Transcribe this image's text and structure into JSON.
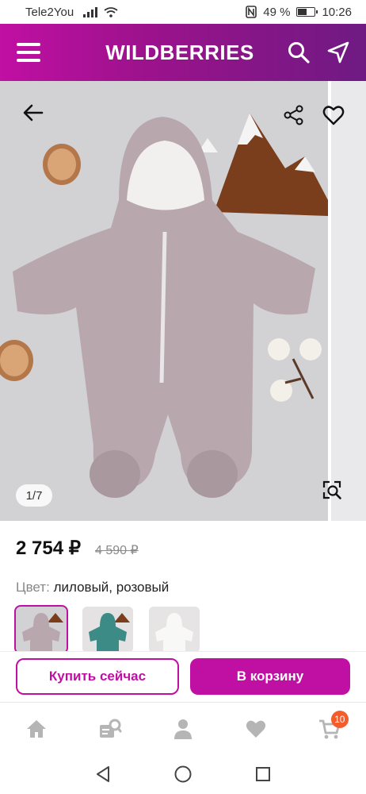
{
  "status_bar": {
    "carrier": "Tele2You",
    "battery": "49 %",
    "time": "10:26"
  },
  "header": {
    "brand": "WILDBERRIES",
    "icons": [
      "menu-icon",
      "search-icon",
      "location-arrow-icon"
    ]
  },
  "gallery": {
    "counter": "1/7",
    "icons": [
      "back-arrow-icon",
      "share-icon",
      "heart-icon",
      "image-search-icon"
    ]
  },
  "product": {
    "price": "2 754 ₽",
    "old_price": "4 590 ₽",
    "color_label": "Цвет:",
    "color_value": "лиловый, розовый",
    "swatches": [
      "лиловый",
      "бирюзовый",
      "белый"
    ]
  },
  "actions": {
    "buy_now": "Купить сейчас",
    "add_to_cart": "В корзину"
  },
  "bottom_nav": {
    "items": [
      "home-icon",
      "catalog-search-icon",
      "profile-icon",
      "favorites-icon",
      "cart-icon"
    ],
    "cart_badge": "10"
  },
  "colors": {
    "brand": "#c00fa3",
    "header_end": "#6f1a83",
    "badge": "#f45c2c"
  }
}
